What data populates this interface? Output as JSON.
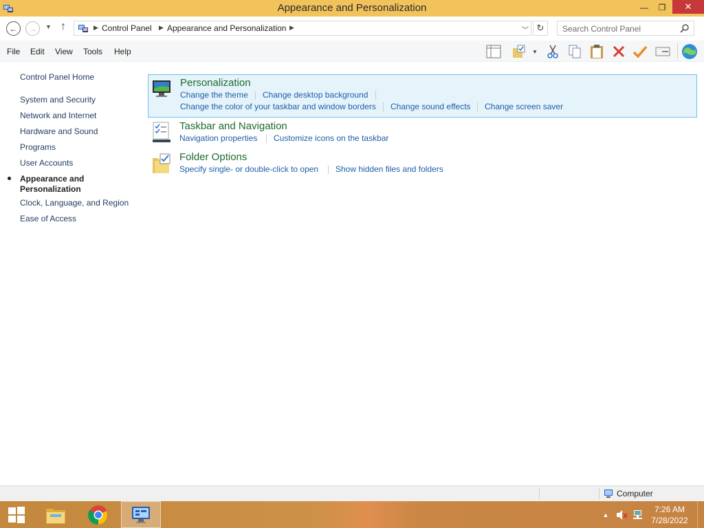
{
  "window": {
    "title": "Appearance and Personalization",
    "minimize_glyph": "—",
    "maximize_glyph": "❐",
    "close_glyph": "✕"
  },
  "address_bar": {
    "breadcrumbs": [
      "Control Panel",
      "Appearance and Personalization"
    ],
    "search_placeholder": "Search Control Panel"
  },
  "menu": [
    "File",
    "Edit",
    "View",
    "Tools",
    "Help"
  ],
  "toolbar_icons": [
    "layout-pane-icon",
    "folder-properties-icon",
    "cut-icon",
    "copy-icon",
    "paste-icon",
    "delete-icon",
    "check-icon",
    "rename-icon",
    "globe-icon"
  ],
  "sidebar": {
    "home": "Control Panel Home",
    "items": [
      "System and Security",
      "Network and Internet",
      "Hardware and Sound",
      "Programs",
      "User Accounts"
    ],
    "current_line1": "Appearance and",
    "current_line2": "Personalization",
    "items_after": [
      "Clock, Language, and Region",
      "Ease of Access"
    ]
  },
  "categories": [
    {
      "title": "Personalization",
      "links": [
        "Change the theme",
        "Change desktop background",
        "Change the color of your taskbar and window borders",
        "Change sound effects",
        "Change screen saver"
      ]
    },
    {
      "title": "Taskbar and Navigation",
      "links": [
        "Navigation properties",
        "Customize icons on the taskbar"
      ]
    },
    {
      "title": "Folder Options",
      "links": [
        "Specify single- or double-click to open",
        "Show hidden files and folders"
      ]
    }
  ],
  "status_bar": {
    "location": "Computer"
  },
  "taskbar": {
    "apps": [
      "start-icon",
      "file-explorer-icon",
      "chrome-icon",
      "control-panel-icon"
    ],
    "time": "7:26 AM",
    "date": "7/28/2022"
  },
  "colors": {
    "titlebar": "#f2c25b",
    "close_button": "#c7383a",
    "category_title": "#1e6b2e",
    "link": "#1e5ea8",
    "highlight_bg": "#e5f3fb",
    "highlight_border": "#70c0e7"
  }
}
